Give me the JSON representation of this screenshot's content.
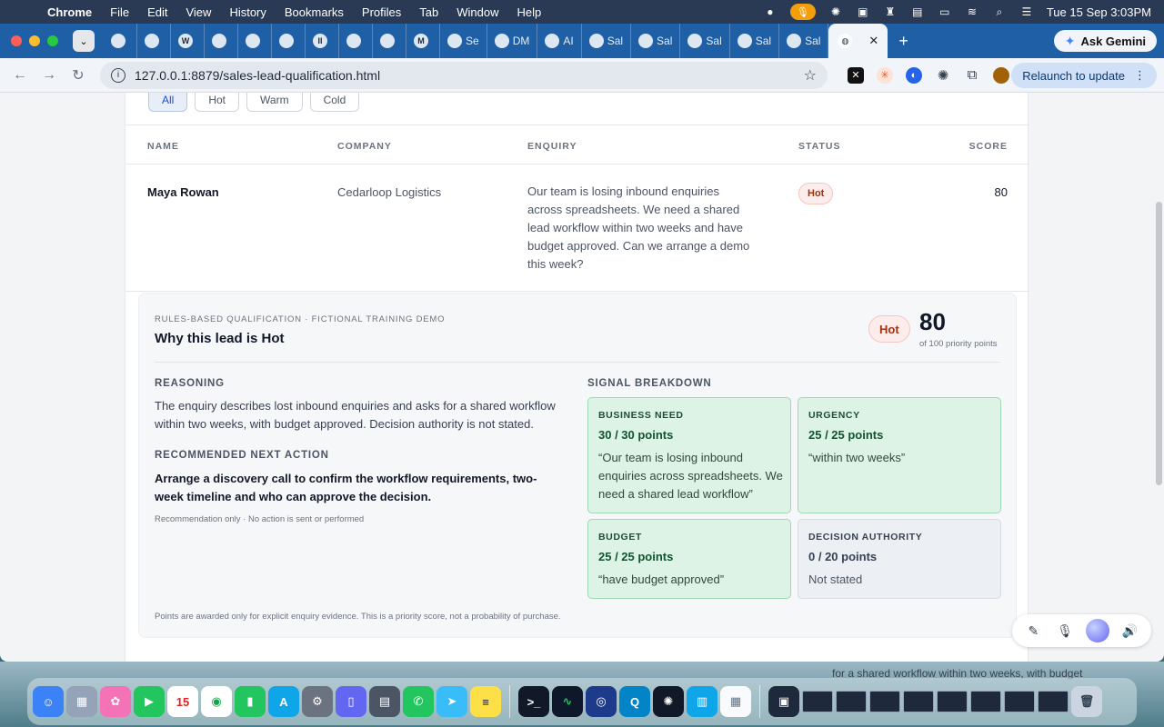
{
  "menubar": {
    "app": "Chrome",
    "items": [
      "File",
      "Edit",
      "View",
      "History",
      "Bookmarks",
      "Profiles",
      "Tab",
      "Window",
      "Help"
    ],
    "datetime": "Tue 15 Sep  3:03PM"
  },
  "tabs": {
    "items": [
      {
        "label": "",
        "fav": ""
      },
      {
        "label": "",
        "fav": ""
      },
      {
        "label": "",
        "fav": "W"
      },
      {
        "label": "",
        "fav": ""
      },
      {
        "label": "",
        "fav": ""
      },
      {
        "label": "",
        "fav": ""
      },
      {
        "label": "",
        "fav": "II"
      },
      {
        "label": "",
        "fav": ""
      },
      {
        "label": "",
        "fav": ""
      },
      {
        "label": "",
        "fav": "M"
      },
      {
        "label": "Se",
        "fav": ""
      },
      {
        "label": "DM",
        "fav": ""
      },
      {
        "label": "AI",
        "fav": ""
      },
      {
        "label": "Sal",
        "fav": ""
      },
      {
        "label": "Sal",
        "fav": ""
      },
      {
        "label": "Sal",
        "fav": ""
      },
      {
        "label": "Sal",
        "fav": ""
      },
      {
        "label": "Sal",
        "fav": ""
      },
      {
        "label": "Sal",
        "fav": ""
      }
    ],
    "ask_gemini": "Ask Gemini"
  },
  "toolbar": {
    "url": "127.0.0.1:8879/sales-lead-qualification.html",
    "relaunch": "Relaunch to update"
  },
  "filters": [
    "All",
    "Hot",
    "Warm",
    "Cold"
  ],
  "table": {
    "headers": {
      "name": "NAME",
      "company": "COMPANY",
      "enquiry": "ENQUIRY",
      "status": "STATUS",
      "score": "SCORE"
    },
    "row": {
      "name": "Maya Rowan",
      "company": "Cedarloop Logistics",
      "enquiry": "Our team is losing inbound enquiries across spreadsheets. We need a shared lead workflow within two weeks and have budget approved. Can we arrange a demo this week?",
      "status": "Hot",
      "score": "80"
    }
  },
  "detail": {
    "eyebrow": "RULES-BASED QUALIFICATION · FICTIONAL TRAINING DEMO",
    "title": "Why this lead is Hot",
    "badge": "Hot",
    "score": "80",
    "score_sub": "of 100 priority points",
    "reasoning_label": "REASONING",
    "reasoning": "The enquiry describes lost inbound enquiries and asks for a shared workflow within two weeks, with budget approved. Decision authority is not stated.",
    "action_label": "RECOMMENDED NEXT ACTION",
    "action": "Arrange a discovery call to confirm the workflow requirements, two-week timeline and who can approve the decision.",
    "rec_note": "Recommendation only · No action is sent or performed",
    "signals_label": "SIGNAL BREAKDOWN",
    "signals": [
      {
        "label": "BUSINESS NEED",
        "points": "30 / 30 points",
        "quote": "“Our team is losing inbound enquiries across spreadsheets. We need a shared lead workflow”"
      },
      {
        "label": "URGENCY",
        "points": "25 / 25 points",
        "quote": "“within two weeks”"
      },
      {
        "label": "BUDGET",
        "points": "25 / 25 points",
        "quote": "“have budget approved”"
      },
      {
        "label": "DECISION AUTHORITY",
        "points": "0 / 20 points",
        "quote": "Not stated"
      }
    ],
    "foot_note": "Points are awarded only for explicit enquiry evidence. This is a priority score, not a probability of purchase."
  },
  "under_text": "for a shared workflow within two weeks, with budget"
}
